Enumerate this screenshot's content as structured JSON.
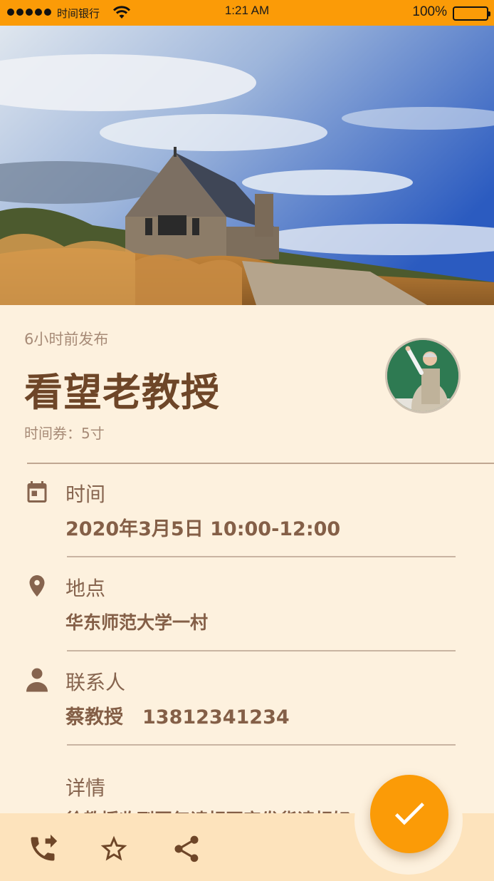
{
  "status_bar": {
    "carrier": "时间银行",
    "time": "1:21 AM",
    "battery": "100%"
  },
  "post": {
    "posted_ago": "6小时前发布",
    "title": "看望老教授",
    "coupon": "时间券：5寸"
  },
  "rows": {
    "time": {
      "label": "时间",
      "value": "2020年3月5日 10:00-12:00",
      "icon": "calendar-icon"
    },
    "location": {
      "label": "地点",
      "value": "华东师范大学一村",
      "icon": "location-pin-icon"
    },
    "contact": {
      "label": "联系人",
      "value": "蔡教授　13812341234",
      "icon": "person-icon"
    },
    "details": {
      "label": "详情",
      "value": "徐教授收到回复请相互审发货请相好"
    }
  },
  "bottom_bar": {
    "icons": [
      "phone-forward-icon",
      "star-icon",
      "share-icon"
    ],
    "fab_icon": "check-icon"
  },
  "colors": {
    "accent": "#fb9b07",
    "background": "#fdf1de",
    "bottom_bar": "#fde3bc",
    "text_primary": "#6e4628"
  }
}
